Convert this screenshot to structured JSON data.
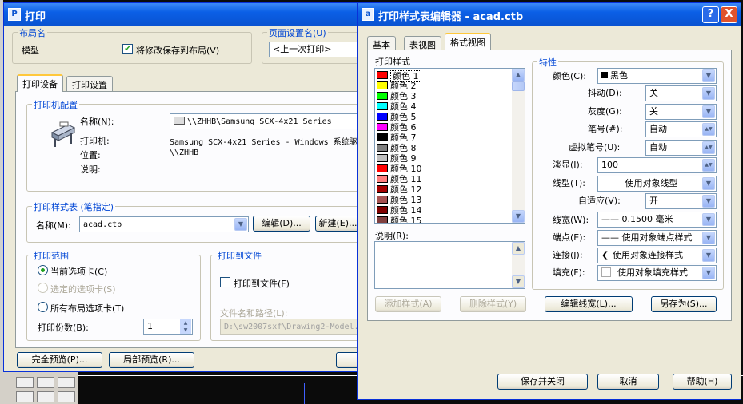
{
  "bg": {
    "dark": "#0b0b0b",
    "panel": "#ece9d8"
  },
  "left": {
    "title": "打印",
    "layout_group": "布局名",
    "layout_name": "模型",
    "save_to_layout": "将修改保存到布局(V)",
    "page_setup_group": "页面设置名(U)",
    "page_setup_value": "<上一次打印>",
    "tabs": [
      "打印设备",
      "打印设置"
    ],
    "printer_group": "打印机配置",
    "name_label": "名称(N):",
    "name_value": "\\\\ZHHB\\Samsung SCX-4x21 Series",
    "printer_label": "打印机:",
    "printer_value": "Samsung SCX-4x21 Series - Windows 系统驱",
    "location_label": "位置:",
    "location_value": "\\\\ZHHB",
    "desc_label": "说明:",
    "style_group": "打印样式表 (笔指定)",
    "style_name_label": "名称(M):",
    "style_name_value": "acad.ctb",
    "edit_button": "编辑(D)...",
    "new_button": "新建(E)...",
    "range_group": "打印范围",
    "range_current": "当前选项卡(C)",
    "range_selected": "选定的选项卡(S)",
    "range_all": "所有布局选项卡(T)",
    "copies_label": "打印份数(B):",
    "copies_value": "1",
    "tofile_group": "打印到文件",
    "tofile_check": "打印到文件(F)",
    "filepath_label": "文件名和路径(L):",
    "filepath_value": "D:\\sw2007sxf\\Drawing2-Model.",
    "full_preview": "完全预览(P)...",
    "partial_preview": "局部预览(R)..."
  },
  "right": {
    "title": "打印样式表编辑器 - acad.ctb",
    "help_btn": "?",
    "close_btn": "X",
    "tabs": [
      "基本",
      "表视图",
      "格式视图"
    ],
    "styles_label": "打印样式",
    "styles": [
      {
        "label": "颜色 1",
        "color": "#ff0000"
      },
      {
        "label": "颜色 2",
        "color": "#ffff00"
      },
      {
        "label": "颜色 3",
        "color": "#00ff00"
      },
      {
        "label": "颜色 4",
        "color": "#00ffff"
      },
      {
        "label": "颜色 5",
        "color": "#0000ff"
      },
      {
        "label": "颜色 6",
        "color": "#ff00ff"
      },
      {
        "label": "颜色 7",
        "color": "#000000"
      },
      {
        "label": "颜色 8",
        "color": "#808080"
      },
      {
        "label": "颜色 9",
        "color": "#c0c0c0"
      },
      {
        "label": "颜色 10",
        "color": "#ff0000"
      },
      {
        "label": "颜色 11",
        "color": "#ff7f7f"
      },
      {
        "label": "颜色 12",
        "color": "#a50000"
      },
      {
        "label": "颜色 13",
        "color": "#a55252"
      },
      {
        "label": "颜色 14",
        "color": "#7f0000"
      },
      {
        "label": "颜色 15",
        "color": "#7f3f3f"
      }
    ],
    "selected_style": "颜色 1",
    "desc_label": "说明(R):",
    "props_group": "特性",
    "color_label": "颜色(C):",
    "color_value": "黑色",
    "dither_label": "抖动(D):",
    "dither_value": "关",
    "gray_label": "灰度(G):",
    "gray_value": "关",
    "pen_label": "笔号(#):",
    "pen_value": "自动",
    "vpen_label": "虚拟笔号(U):",
    "vpen_value": "自动",
    "screen_label": "淡显(I):",
    "screen_value": "100",
    "linetype_label": "线型(T):",
    "linetype_value": "使用对象线型",
    "adaptive_label": "自适应(V):",
    "adaptive_value": "开",
    "lineweight_label": "线宽(W):",
    "lineweight_value": "—— 0.1500 毫米",
    "endstyle_label": "端点(E):",
    "endstyle_value": "—— 使用对象端点样式",
    "joinstyle_label": "连接(J):",
    "joinstyle_value": "使用对象连接样式",
    "fill_label": "填充(F):",
    "fill_value": "使用对象填充样式",
    "add_style": "添加样式(A)",
    "delete_style": "删除样式(Y)",
    "edit_lineweights": "编辑线宽(L)...",
    "save_as": "另存为(S)...",
    "save_close": "保存并关闭",
    "cancel": "取消",
    "help": "帮助(H)"
  }
}
